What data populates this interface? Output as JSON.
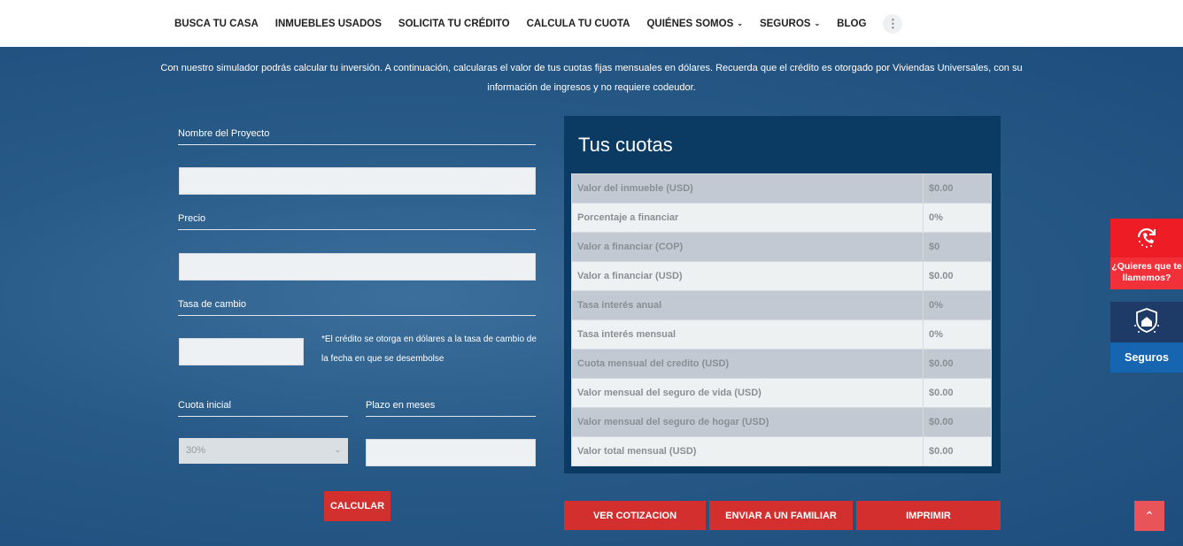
{
  "nav": {
    "items": [
      {
        "label": "BUSCA TU CASA"
      },
      {
        "label": "INMUEBLES USADOS"
      },
      {
        "label": "SOLICITA TU CRÉDITO"
      },
      {
        "label": "CALCULA TU CUOTA"
      },
      {
        "label": "QUIÉNES SOMOS",
        "chevron": true
      },
      {
        "label": "SEGUROS",
        "chevron": true
      },
      {
        "label": "BLOG"
      }
    ],
    "more": "⋮"
  },
  "intro": "Con nuestro simulador podrás calcular tu inversión. A continuación, calcularas el valor de tus cuotas fijas mensuales en dólares. Recuerda que el crédito es otorgado por Viviendas Universales, con su información de ingresos y no requiere codeudor.",
  "form": {
    "nombre_label": "Nombre del Proyecto",
    "precio_label": "Precio",
    "tasa_label": "Tasa de cambio",
    "tasa_note": "*El crédito se otorga en dólares a la tasa de cambio de la fecha en que se desembolse",
    "cuota_label": "Cuota inicial",
    "cuota_value": "30%",
    "plazo_label": "Plazo en meses",
    "calcular": "CALCULAR"
  },
  "panel": {
    "title": "Tus cuotas",
    "rows": [
      {
        "label": "Valor del inmueble (USD)",
        "value": "$0.00"
      },
      {
        "label": "Porcentaje a financiar",
        "value": "0%"
      },
      {
        "label": "Valor a financiar (COP)",
        "value": "$0"
      },
      {
        "label": "Valor a financiar (USD)",
        "value": "$0.00"
      },
      {
        "label": "Tasa interés anual",
        "value": "0%"
      },
      {
        "label": "Tasa interés mensual",
        "value": "0%"
      },
      {
        "label": "Cuota mensual del credito (USD)",
        "value": "$0.00"
      },
      {
        "label": "Valor mensual del seguro de vida (USD)",
        "value": "$0.00"
      },
      {
        "label": "Valor mensual del seguro de hogar (USD)",
        "value": "$0.00"
      },
      {
        "label": "Valor total mensual (USD)",
        "value": "$0.00"
      }
    ]
  },
  "actions": {
    "ver": "VER COTIZACION",
    "enviar": "ENVIAR A UN FAMILIAR",
    "imprimir": "IMPRIMIR"
  },
  "side": {
    "call": "¿Quieres que te llamemos?",
    "seguros": "Seguros"
  },
  "colors": {
    "accent": "#d32f2f",
    "panel": "#0b3a63",
    "side_red": "#ee2b35",
    "side_blue": "#1565b0"
  }
}
